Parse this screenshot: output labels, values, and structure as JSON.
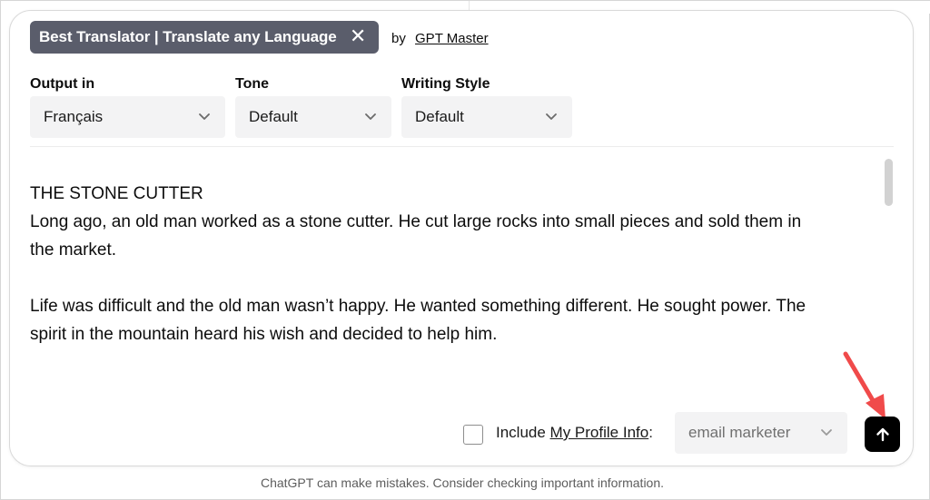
{
  "gpt": {
    "name": "Best Translator | Translate any Language",
    "by_label": "by",
    "author": "GPT Master",
    "close_glyph": "✕"
  },
  "options": {
    "output_label": "Output in",
    "output_value": "Français",
    "tone_label": "Tone",
    "tone_value": "Default",
    "style_label": "Writing Style",
    "style_value": "Default"
  },
  "message": {
    "line1": "THE STONE CUTTER",
    "line2": "Long ago, an old man worked as a stone cutter. He cut large rocks into small pieces and sold them in the market.",
    "line3": "Life was difficult and the old man wasn’t happy. He wanted something different. He sought power. The spirit in the mountain heard his wish and decided to help him."
  },
  "profile": {
    "include_prefix": "Include ",
    "link_text": "My Profile Info",
    "colon": ":",
    "selected": "email marketer"
  },
  "footer": {
    "disclaimer": "ChatGPT can make mistakes. Consider checking important information."
  },
  "colors": {
    "chip_bg": "#5a5d6b",
    "send_bg": "#000000",
    "annotation_arrow": "#f04a4a",
    "select_bg": "#f3f3f4"
  },
  "icons": {
    "close": "close-icon",
    "chevron": "chevron-down-icon",
    "send": "arrow-up-icon",
    "annotation": "red-arrow-icon"
  }
}
